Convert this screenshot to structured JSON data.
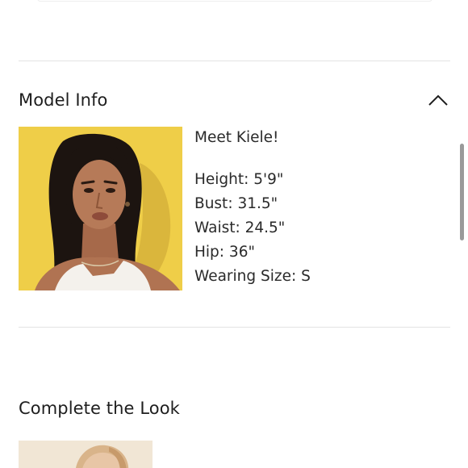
{
  "model_info": {
    "title": "Model Info",
    "expanded": true,
    "greeting": "Meet Kiele!",
    "stats": [
      {
        "label": "Height",
        "value": "5'9\""
      },
      {
        "label": "Bust",
        "value": "31.5\""
      },
      {
        "label": "Waist",
        "value": "24.5\""
      },
      {
        "label": "Hip",
        "value": "36\""
      },
      {
        "label": "Wearing Size",
        "value": "S"
      }
    ],
    "photo_background": "#f0d050"
  },
  "complete_the_look": {
    "title": "Complete the Look"
  },
  "icons": {
    "collapse": "chevron-up-icon"
  }
}
